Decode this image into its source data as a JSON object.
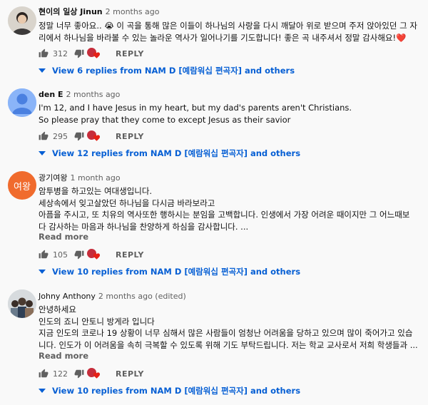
{
  "comments": [
    {
      "author": "현이의 일상 Jinun",
      "time": "2 months ago",
      "lines": [
        "정말 너무 좋아요.. 😭 이 곡을 통해 많은 이들이 하나님의 사랑을 다시 깨달아 위로 받으며 주저 앉아있던 그 자",
        "리에서 하나님을 바라볼 수 있는 놀라운 역사가 일어나기를 기도합니다! 좋은 곡 내주셔서 정말 감사해요!❤️"
      ],
      "read_more": "",
      "likes": "312",
      "reply_label": "REPLY",
      "view_replies": "View 6 replies from NAM D [예람워십 편곡자] and others"
    },
    {
      "author": "den E",
      "time": "2 months ago",
      "lines": [
        "I'm 12, and I have Jesus in my heart, but my dad's parents aren't Christians.",
        "So please pray that they come to except Jesus as their savior"
      ],
      "read_more": "",
      "likes": "295",
      "reply_label": "REPLY",
      "view_replies": "View 12 replies from NAM D [예람워십 편곡자] and others"
    },
    {
      "author": "광기여왕",
      "avatar_text": "여왕",
      "time": "1 month ago",
      "lines": [
        "암투병을 하고있는 여대생입니다.",
        "세상속에서 잊고살았던 하나님을 다시금 바라보라고",
        "아픔을 주시고, 또 치유의 역사또한 행하시는 분임을 고백합니다. 인생에서 가장 어려운 때이지만 그 어느때보",
        "다 감사하는 마음과 하나님을 찬양하게 하심을 감사합니다. ..."
      ],
      "read_more": "Read more",
      "likes": "105",
      "reply_label": "REPLY",
      "view_replies": "View 10 replies from NAM D [예람워십 편곡자] and others"
    },
    {
      "author": "Johny Anthony",
      "time": "2 months ago (edited)",
      "lines": [
        "안녕하세요",
        "인도의 죠니 안토니 방게라 입니다",
        "지금 인도의 코로나 19 상황이 너무 심해서 많은 사람들이 엄청난 어려움을 당하고 있으며 많이 죽어가고 있습",
        "니다. 인도가 이 어려움을 속히 극복할 수 있도록 위해 기도 부탁드립니다. 저는 학교 교사로서 저희 학생들과 ..."
      ],
      "read_more": "Read more",
      "likes": "122",
      "reply_label": "REPLY",
      "view_replies": "View 10 replies from NAM D [예람워십 편곡자] and others"
    }
  ],
  "colors": {
    "link_blue": "#065fd4",
    "secondary_text": "#606060",
    "heart_red": "#e62117",
    "avatar_orange": "#f06b2d",
    "avatar_blue": "#8ab4f8"
  }
}
